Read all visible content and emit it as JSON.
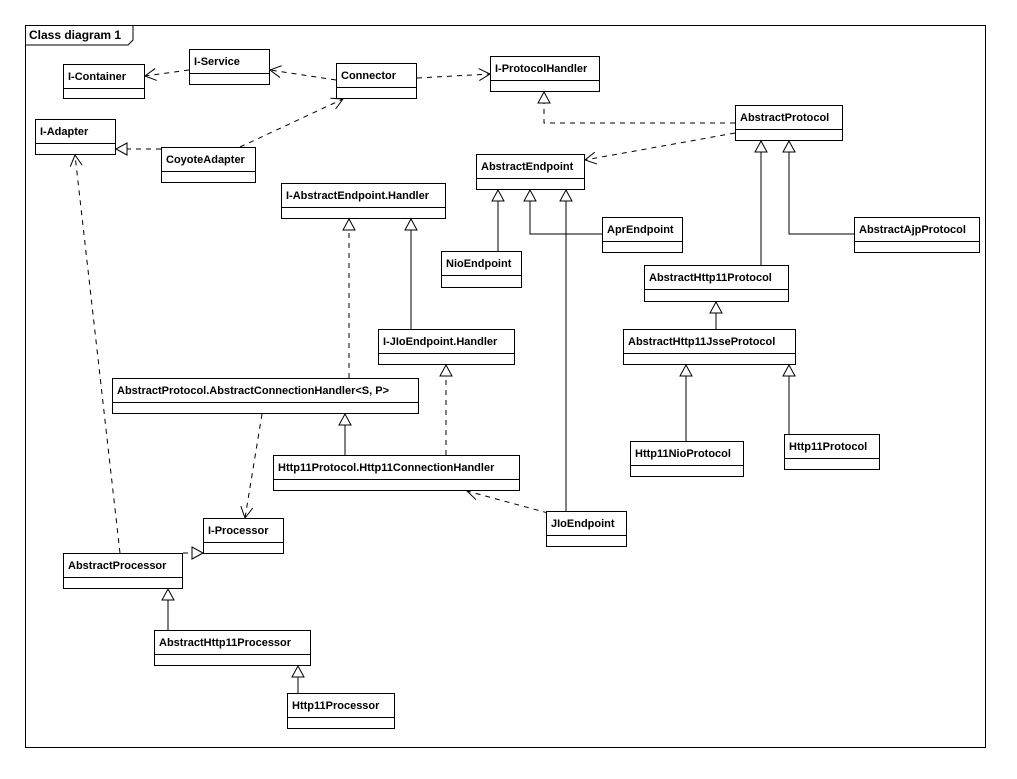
{
  "frame": {
    "title": "Class diagram 1"
  },
  "classes": {
    "icontainer": {
      "name": "I-Container"
    },
    "iservice": {
      "name": "I-Service"
    },
    "connector": {
      "name": "Connector"
    },
    "iprotocolhandler": {
      "name": "I-ProtocolHandler"
    },
    "abstractprotocol": {
      "name": "AbstractProtocol"
    },
    "iadapter": {
      "name": "I-Adapter"
    },
    "coyoteadapter": {
      "name": "CoyoteAdapter"
    },
    "abstractendpoint": {
      "name": "AbstractEndpoint"
    },
    "iabstractendpointhandler": {
      "name": "I-AbstractEndpoint.Handler"
    },
    "nioendpoint": {
      "name": "NioEndpoint"
    },
    "aprendpoint": {
      "name": "AprEndpoint"
    },
    "abstractajpprotocol": {
      "name": "AbstractAjpProtocol"
    },
    "abstracthttp11protocol": {
      "name": "AbstractHttp11Protocol"
    },
    "abstracthttp11jsseprotocol": {
      "name": "AbstractHttp11JsseProtocol"
    },
    "ijioendpointhandler": {
      "name": "I-JIoEndpoint.Handler"
    },
    "abstractconnectionhandler": {
      "name": "AbstractProtocol.AbstractConnectionHandler<S, P>"
    },
    "http11nioprotocol": {
      "name": "Http11NioProtocol"
    },
    "http11protocol": {
      "name": "Http11Protocol"
    },
    "http11connectionhandler": {
      "name": "Http11Protocol.Http11ConnectionHandler"
    },
    "iprocessor": {
      "name": "I-Processor"
    },
    "jioendpoint": {
      "name": "JIoEndpoint"
    },
    "abstractprocessor": {
      "name": "AbstractProcessor"
    },
    "abstracthttp11processor": {
      "name": "AbstractHttp11Processor"
    },
    "http11processor": {
      "name": "Http11Processor"
    }
  },
  "relationships": [
    {
      "from": "iservice",
      "to": "icontainer",
      "type": "dependency"
    },
    {
      "from": "connector",
      "to": "iservice",
      "type": "dependency"
    },
    {
      "from": "connector",
      "to": "iprotocolhandler",
      "type": "dependency"
    },
    {
      "from": "coyoteadapter",
      "to": "connector",
      "type": "dependency"
    },
    {
      "from": "coyoteadapter",
      "to": "iadapter",
      "type": "realization"
    },
    {
      "from": "abstractprotocol",
      "to": "iprotocolhandler",
      "type": "realization"
    },
    {
      "from": "abstractprotocol",
      "to": "abstractendpoint",
      "type": "dependency"
    },
    {
      "from": "nioendpoint",
      "to": "abstractendpoint",
      "type": "generalization"
    },
    {
      "from": "aprendpoint",
      "to": "abstractendpoint",
      "type": "generalization"
    },
    {
      "from": "jioendpoint",
      "to": "abstractendpoint",
      "type": "generalization"
    },
    {
      "from": "abstracthttp11protocol",
      "to": "abstractprotocol",
      "type": "generalization"
    },
    {
      "from": "abstractajpprotocol",
      "to": "abstractprotocol",
      "type": "generalization"
    },
    {
      "from": "abstracthttp11jsseprotocol",
      "to": "abstracthttp11protocol",
      "type": "generalization"
    },
    {
      "from": "http11nioprotocol",
      "to": "abstracthttp11jsseprotocol",
      "type": "generalization"
    },
    {
      "from": "http11protocol",
      "to": "abstracthttp11jsseprotocol",
      "type": "generalization"
    },
    {
      "from": "abstractconnectionhandler",
      "to": "iabstractendpointhandler",
      "type": "realization"
    },
    {
      "from": "ijioendpointhandler",
      "to": "iabstractendpointhandler",
      "type": "generalization"
    },
    {
      "from": "http11connectionhandler",
      "to": "abstractconnectionhandler",
      "type": "generalization"
    },
    {
      "from": "http11connectionhandler",
      "to": "ijioendpointhandler",
      "type": "realization"
    },
    {
      "from": "abstractconnectionhandler",
      "to": "iprocessor",
      "type": "dependency"
    },
    {
      "from": "jioendpoint",
      "to": "http11connectionhandler",
      "type": "dependency"
    },
    {
      "from": "abstractprocessor",
      "to": "iprocessor",
      "type": "realization"
    },
    {
      "from": "abstractprocessor",
      "to": "iadapter",
      "type": "dependency"
    },
    {
      "from": "abstracthttp11processor",
      "to": "abstractprocessor",
      "type": "generalization"
    },
    {
      "from": "http11processor",
      "to": "abstracthttp11processor",
      "type": "generalization"
    }
  ]
}
